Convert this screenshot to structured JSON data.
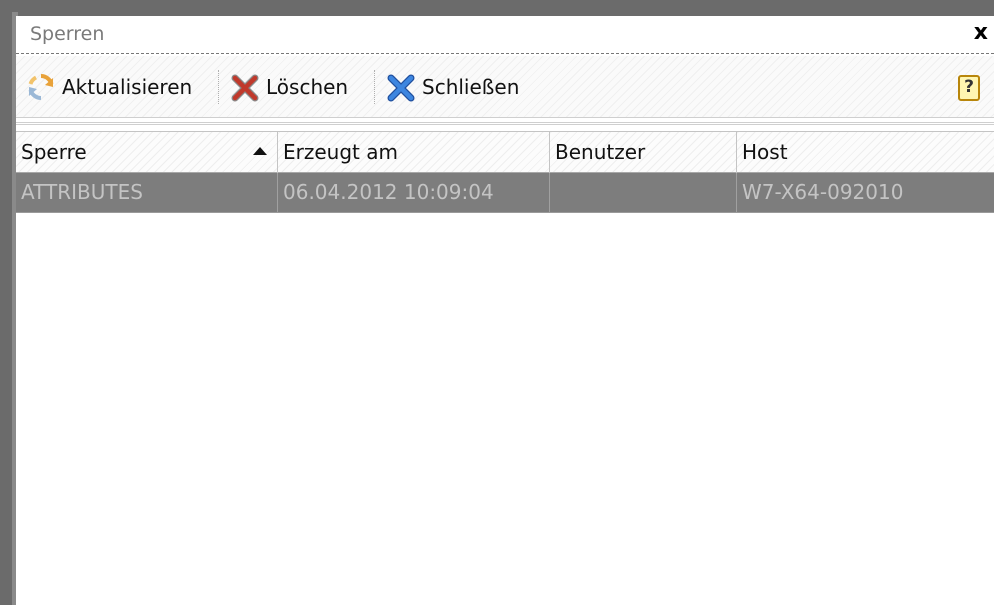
{
  "window": {
    "title": "Sperren",
    "close_glyph": "x"
  },
  "toolbar": {
    "refresh_label": "Aktualisieren",
    "refresh_icon": "refresh-icon",
    "delete_label": "Löschen",
    "delete_icon": "delete-x-icon",
    "close_label": "Schließen",
    "close_icon": "close-x-icon",
    "help_glyph": "?"
  },
  "table": {
    "columns": [
      "Sperre",
      "Erzeugt am",
      "Benutzer",
      "Host"
    ],
    "sorted_column": "Sperre",
    "sort_direction": "ascending",
    "rows": [
      {
        "sperre": "ATTRIBUTES",
        "erzeugt_am": "06.04.2012 10:09:04",
        "benutzer": "",
        "host": "W7-X64-092010",
        "selected": true
      }
    ]
  },
  "colors": {
    "border": "#6b6b6b",
    "selected_row": "#7d7d7d",
    "selected_text": "#c4c4c4",
    "delete_icon": "#c0392b",
    "close_icon": "#2e6fd1",
    "refresh_icon": "#e8a23a"
  }
}
